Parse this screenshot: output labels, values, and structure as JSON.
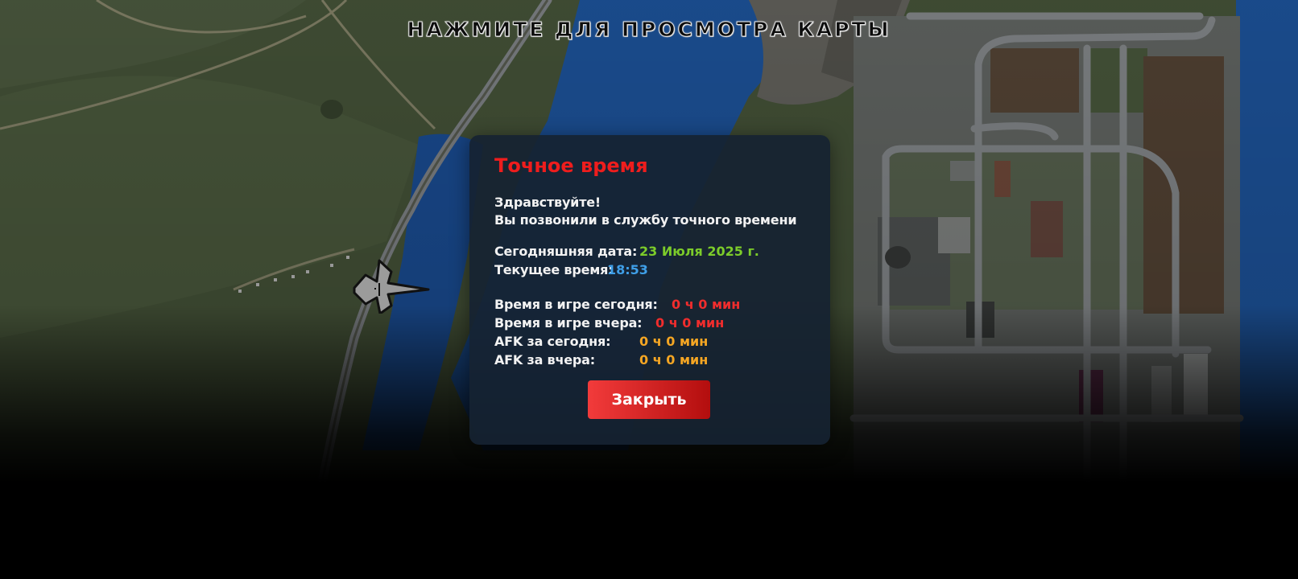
{
  "map": {
    "hint": "НАЖМИТЕ ДЛЯ ПРОСМОТРА КАРТЫ",
    "colors": {
      "grass": "#4a5a3c",
      "water": "#1f5aa8",
      "road": "#8f9396",
      "city": "#6a6e6b",
      "field": "#5c4a3a"
    },
    "player_marker_icon": "player-arrow-icon"
  },
  "dialog": {
    "title": "Точное время",
    "greeting": "Здравствуйте!",
    "intro": "Вы позвонили в службу точного времени",
    "date_label": "Сегодняшняя дата:",
    "date_value": "23 Июля 2025 г.",
    "time_label": "Текущее время:",
    "time_value": "18:53",
    "stats": {
      "today_label": "Время в игре сегодня:",
      "today_value": "0 ч 0 мин",
      "yesterday_label": "Время в игре вчера:",
      "yesterday_value": "0 ч 0 мин",
      "afk_today_label": "AFK за сегодня:",
      "afk_today_value": "0 ч 0 мин",
      "afk_yesterday_label": "AFK за вчера:",
      "afk_yesterday_value": "0 ч 0 мин"
    },
    "close_label": "Закрыть",
    "colors": {
      "title": "#ee1d1d",
      "date": "#7ccc2a",
      "time": "#3f9fe8",
      "ingame": "#f02d2d",
      "afk": "#f5a623"
    }
  }
}
